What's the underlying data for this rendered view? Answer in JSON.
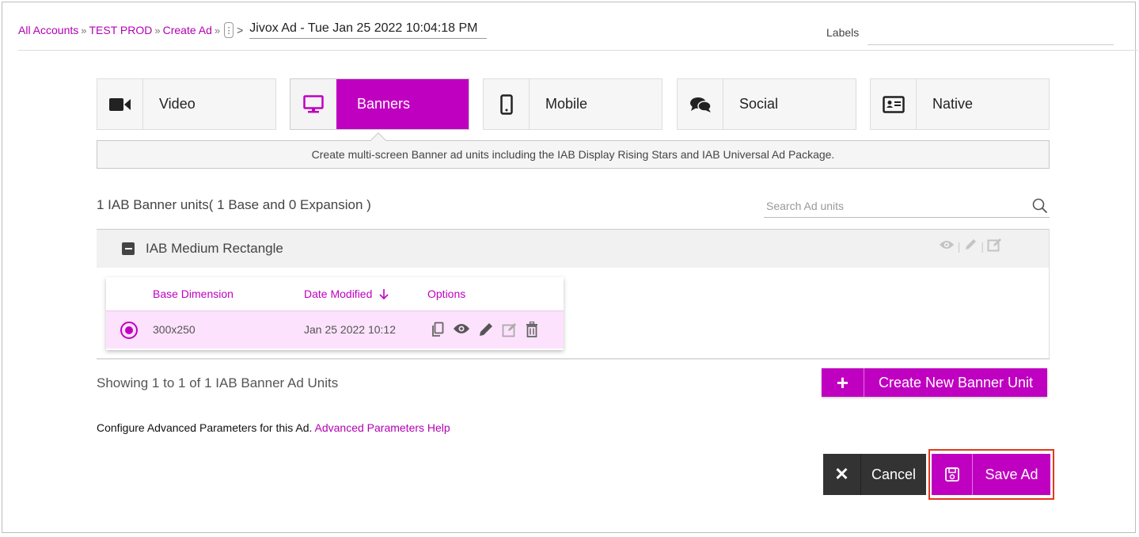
{
  "breadcrumb": {
    "items": [
      "All Accounts",
      "TEST PROD",
      "Create Ad"
    ],
    "separator": "»",
    "menu_glyph": "⋮",
    "arrow": ">",
    "ad_name": "Jivox Ad - Tue Jan 25 2022 10:04:18 PM"
  },
  "labels": {
    "label": "Labels",
    "value": ""
  },
  "tabs": [
    {
      "label": "Video",
      "icon": "video-camera-icon",
      "active": false
    },
    {
      "label": "Banners",
      "icon": "desktop-monitor-icon",
      "active": true
    },
    {
      "label": "Mobile",
      "icon": "mobile-phone-icon",
      "active": false
    },
    {
      "label": "Social",
      "icon": "chat-bubbles-icon",
      "active": false
    },
    {
      "label": "Native",
      "icon": "id-card-icon",
      "active": false
    }
  ],
  "description": "Create multi-screen Banner ad units including the IAB Display Rising Stars and IAB Universal Ad Package.",
  "units_summary": "1 IAB Banner units( 1 Base and 0 Expansion )",
  "search": {
    "placeholder": "Search Ad units",
    "value": ""
  },
  "group": {
    "title": "IAB Medium Rectangle",
    "actions": [
      "eye-icon",
      "pencil-icon",
      "edit-square-icon"
    ],
    "table": {
      "columns": [
        "Base Dimension",
        "Date Modified",
        "Options"
      ],
      "sort_column": "Date Modified",
      "sort_direction": "descending",
      "rows": [
        {
          "selected": true,
          "dimension": "300x250",
          "date_modified": "Jan 25 2022 10:12",
          "options": [
            "copy-icon",
            "eye-icon",
            "pencil-icon",
            "edit-square-icon",
            "trash-icon"
          ]
        }
      ]
    }
  },
  "showing": "Showing 1 to 1 of 1 IAB Banner Ad Units",
  "create_button": {
    "label": "Create New Banner Unit",
    "icon": "plus-icon"
  },
  "advanced": {
    "text": "Configure Advanced Parameters for this Ad.",
    "link": "Advanced Parameters Help"
  },
  "footer": {
    "cancel_label": "Cancel",
    "save_label": "Save Ad"
  },
  "colors": {
    "accent": "#c000c0",
    "dark_button": "#333333",
    "highlight_outline": "#e03a1a",
    "selected_row": "#fde2fd"
  }
}
